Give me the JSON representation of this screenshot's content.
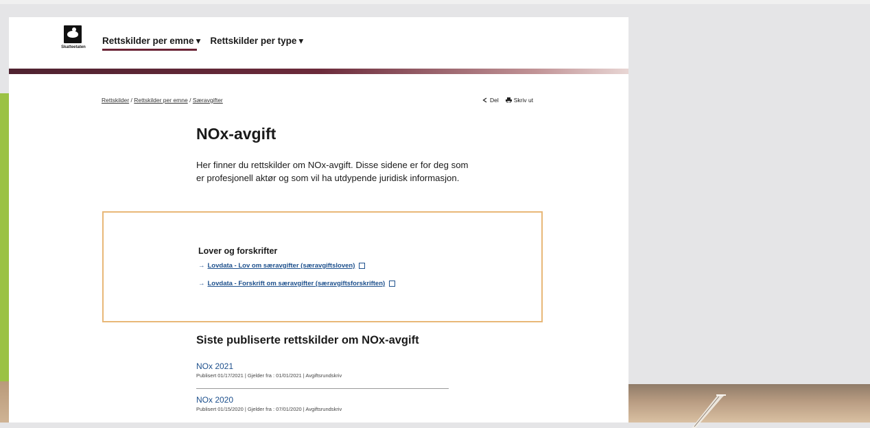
{
  "logo": {
    "text": "Skatteetaten"
  },
  "nav": [
    {
      "label": "Rettskilder per emne",
      "caret": "▾"
    },
    {
      "label": "Rettskilder per type",
      "caret": "▾"
    }
  ],
  "breadcrumb": {
    "items": [
      "Rettskilder",
      "Rettskilder per emne",
      "Særavgifter"
    ],
    "separator": "/"
  },
  "actions": {
    "share": {
      "icon": "share-icon",
      "label": "Del"
    },
    "print": {
      "icon": "print-icon",
      "label": "Skriv ut"
    }
  },
  "page": {
    "title": "NOx-avgift",
    "intro": "Her finner du rettskilder om NOx-avgift. Disse sidene er for deg som er profesjonell aktør og som vil ha utdypende juridisk informasjon."
  },
  "laws_box": {
    "heading": "Lover og forskrifter",
    "links": [
      "Lovdata - Lov om særavgifter (særavgiftsloven)",
      "Lovdata - Forskrift om særavgifter (særavgiftsforskriften)"
    ]
  },
  "latest": {
    "heading": "Siste publiserte rettskilder om NOx-avgift",
    "items": [
      {
        "title": "NOx 2021",
        "meta": "Publisert 01/17/2021 | Gjelder fra : 01/01/2021 | Avgiftsrundskriv"
      },
      {
        "title": "NOx 2020",
        "meta": "Publisert 01/15/2020 | Gjelder fra : 07/01/2020 | Avgiftsrundskriv"
      }
    ]
  },
  "colors": {
    "brand": "#6b2436",
    "link": "#1c4f8c",
    "box_border": "#e8b777",
    "side_green": "#9bc244"
  }
}
